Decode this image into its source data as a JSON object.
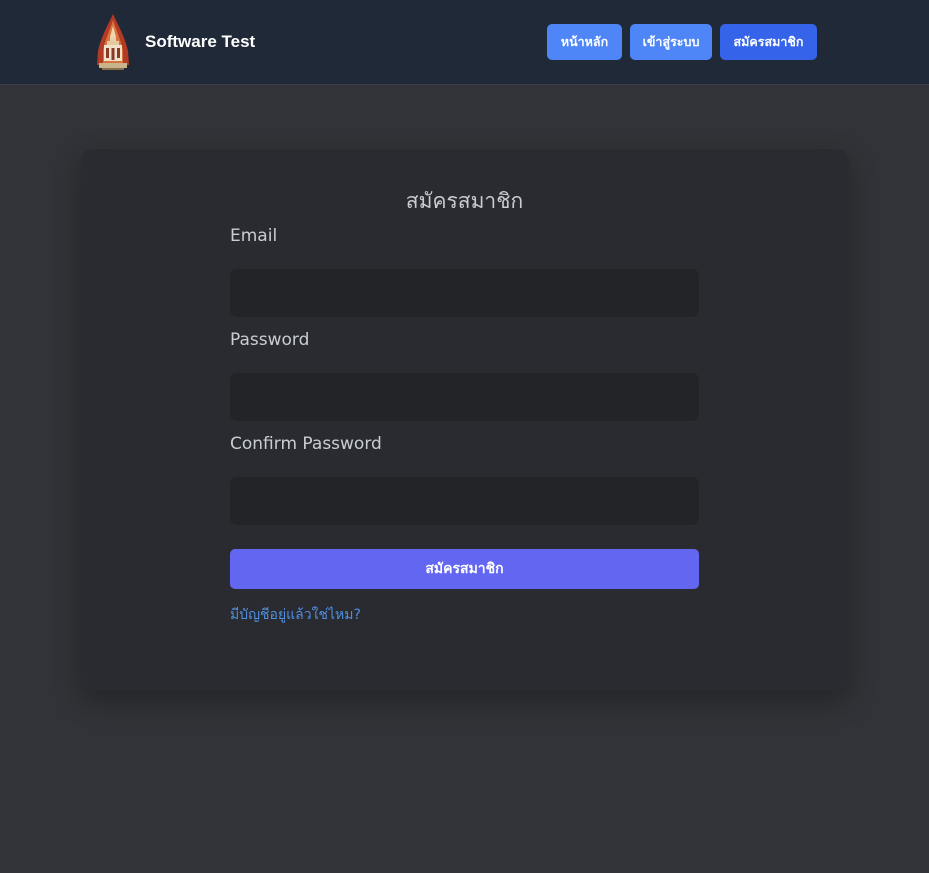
{
  "header": {
    "app_name": "Software Test",
    "logo_icon": "temple-crest-logo",
    "nav": {
      "home_label": "หน้าหลัก",
      "login_label": "เข้าสู่ระบบ",
      "register_label": "สมัครสมาชิก"
    }
  },
  "form": {
    "title": "สมัครสมาชิก",
    "email_label": "Email",
    "email_value": "",
    "password_label": "Password",
    "password_value": "",
    "confirm_password_label": "Confirm Password",
    "confirm_password_value": "",
    "submit_label": "สมัครสมาชิก",
    "login_link_text": "มีบัญชีอยู่แล้วใช่ไหม?"
  },
  "colors": {
    "navbar_bg": "#1f2937",
    "page_bg": "#323338",
    "card_bg": "#2a2b30",
    "input_bg": "#232428",
    "nav_button": "#4f86f7",
    "nav_button_active": "#3563e9",
    "submit_button": "#6366f1",
    "link": "#4f8fe0"
  }
}
